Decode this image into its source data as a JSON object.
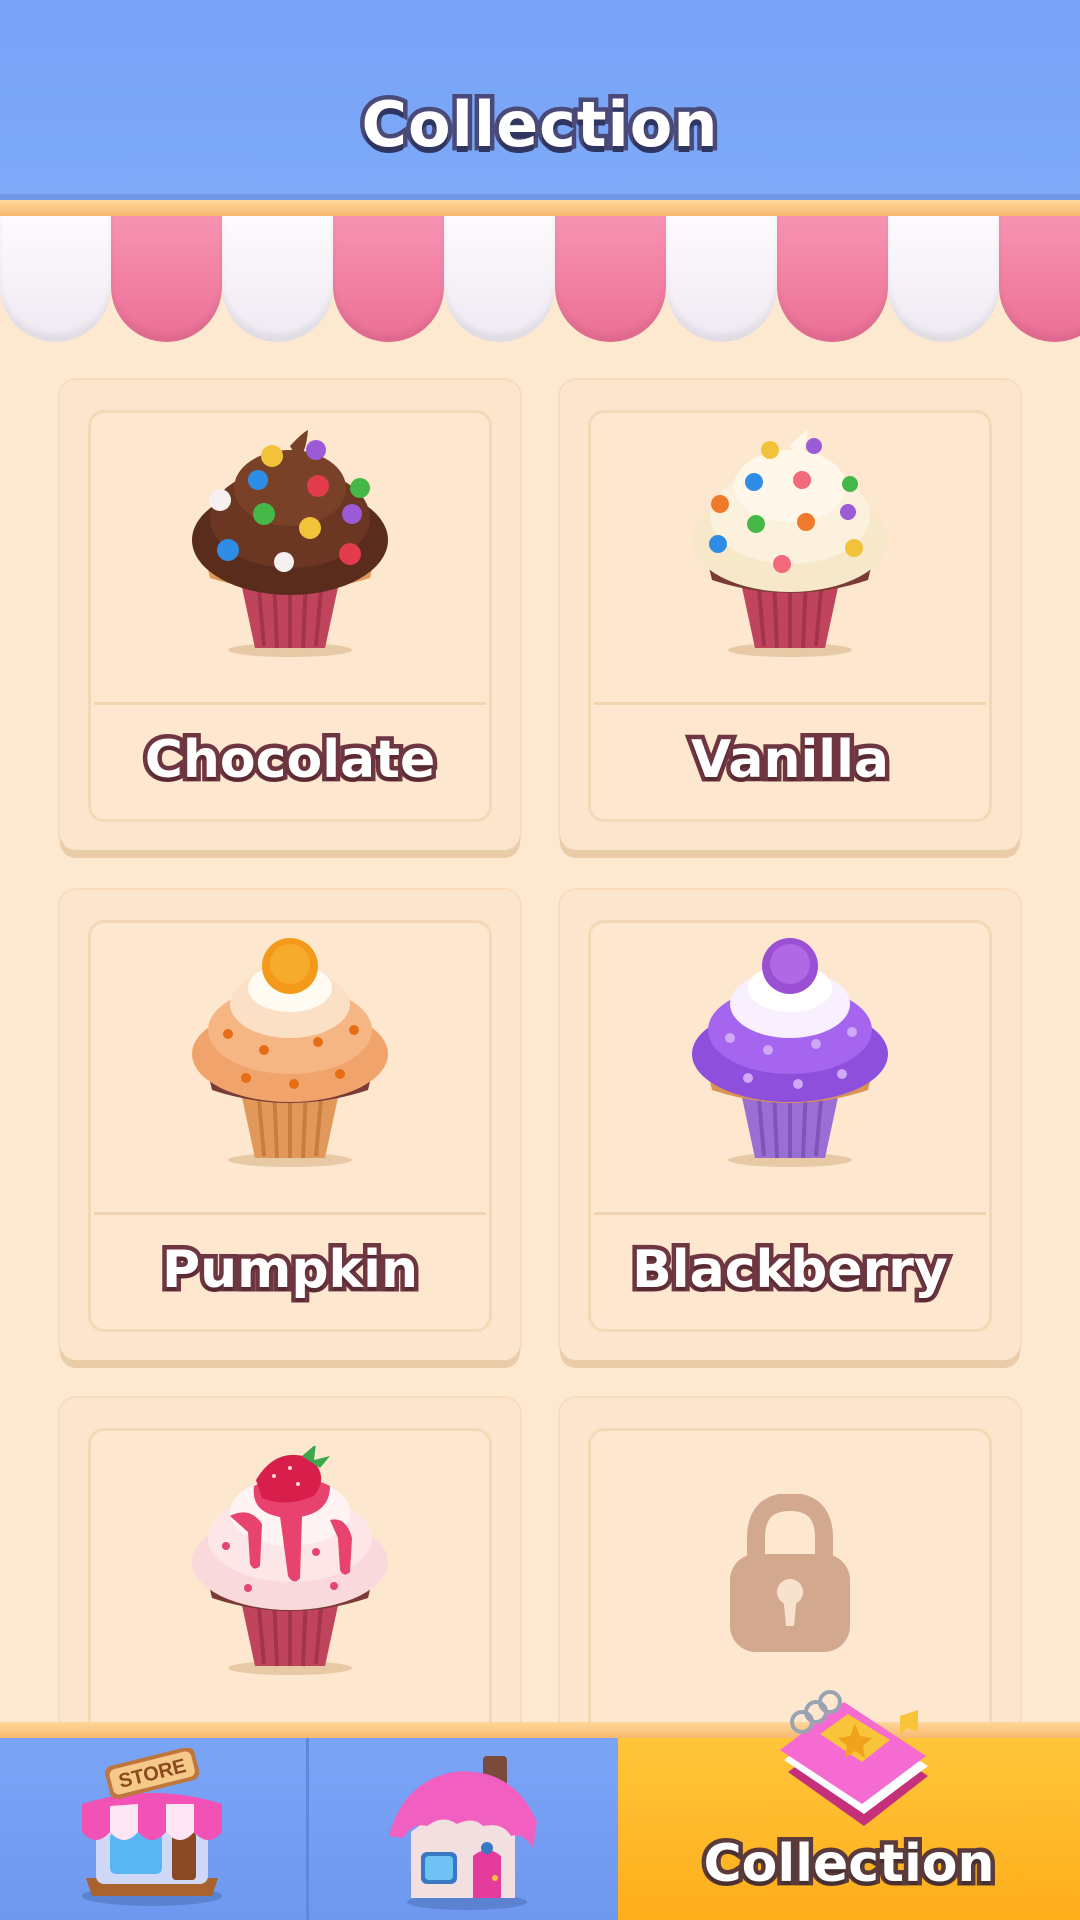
{
  "header": {
    "title": "Collection"
  },
  "collection": {
    "items": [
      {
        "label": "Chocolate",
        "icon": "chocolate-cupcake-icon",
        "locked": false
      },
      {
        "label": "Vanilla",
        "icon": "vanilla-cupcake-icon",
        "locked": false
      },
      {
        "label": "Pumpkin",
        "icon": "pumpkin-cupcake-icon",
        "locked": false
      },
      {
        "label": "Blackberry",
        "icon": "blackberry-cupcake-icon",
        "locked": false
      },
      {
        "label": "",
        "icon": "strawberry-cupcake-icon",
        "locked": false
      },
      {
        "label": "",
        "icon": "lock-icon",
        "locked": true
      }
    ]
  },
  "bottom_nav": {
    "store_sign": "STORE",
    "tabs": [
      {
        "icon": "store-icon",
        "label": ""
      },
      {
        "icon": "house-icon",
        "label": ""
      },
      {
        "icon": "collection-book-icon",
        "label": "Collection",
        "active": true
      }
    ]
  },
  "colors": {
    "header_blue": "#7eaaf8",
    "awning_pink": "#ec6f96",
    "card_cream": "#fbe6cd",
    "active_tab_yellow": "#ffad1b",
    "label_outline": "#6e3640"
  }
}
